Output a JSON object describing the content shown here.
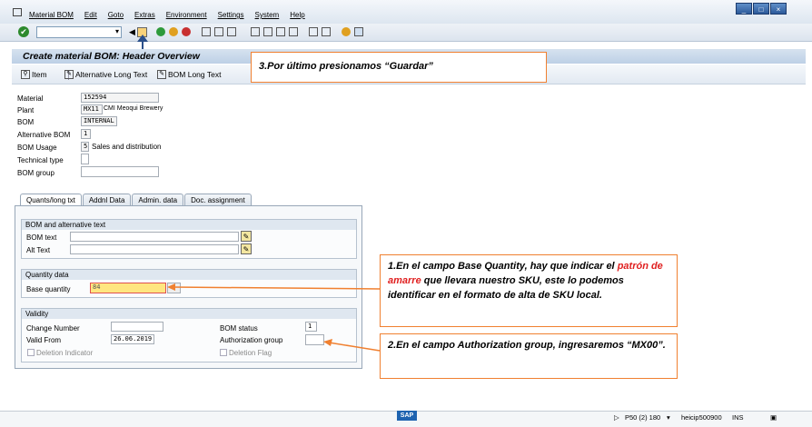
{
  "menu": {
    "items": [
      "Material BOM",
      "Edit",
      "Goto",
      "Extras",
      "Environment",
      "Settings",
      "System",
      "Help"
    ]
  },
  "window_controls": [
    "_",
    "□",
    "×"
  ],
  "header": {
    "title": "Create material BOM: Header Overview"
  },
  "app_toolbar": {
    "item_label": "Item",
    "alt_long_text_label": "Alternative Long Text",
    "bom_long_text_label": "BOM Long Text"
  },
  "fields": {
    "material": {
      "label": "Material",
      "value": "152594"
    },
    "plant": {
      "label": "Plant",
      "value": "MX11",
      "text": "CMI Meoqui Brewery"
    },
    "bom": {
      "label": "BOM",
      "value": "INTERNAL"
    },
    "alt_bom": {
      "label": "Alternative BOM",
      "value": "1"
    },
    "bom_usage": {
      "label": "BOM Usage",
      "value": "5",
      "text": "Sales and distribution"
    },
    "technical_type": {
      "label": "Technical type",
      "value": ""
    },
    "bom_group": {
      "label": "BOM group",
      "value": ""
    }
  },
  "tabs": [
    "Quants/long txt",
    "Addnl Data",
    "Admin. data",
    "Doc. assignment"
  ],
  "groups": {
    "bom_alt_text": {
      "title": "BOM and alternative text",
      "bom_text_label": "BOM text",
      "alt_text_label": "Alt Text"
    },
    "quantity": {
      "title": "Quantity data",
      "base_qty_label": "Base quantity",
      "base_qty_value": "84"
    },
    "validity": {
      "title": "Validity",
      "change_number_label": "Change Number",
      "valid_from_label": "Valid From",
      "valid_from_value": "26.06.2019",
      "deletion_indicator_label": "Deletion Indicator",
      "bom_status_label": "BOM status",
      "bom_status_value": "1",
      "auth_group_label": "Authorization group",
      "deletion_flag_label": "Deletion Flag"
    }
  },
  "callouts": {
    "save": "3.Por último presionamos “Guardar”",
    "base_qty_1": "1.En el campo Base Quantity, hay que indicar el",
    "base_qty_red": "patrón de amarre",
    "base_qty_2": "que llevara nuestro SKU, este lo podemos identificar en el formato de alta de SKU local.",
    "auth_group": "2.En el campo Authorization group, ingresaremos “MX00”."
  },
  "status": {
    "logo": "SAP",
    "system": "P50 (2) 180",
    "server": "heicip500900",
    "mode": "INS"
  },
  "colors": {
    "callout_border": "#f08030",
    "highlight_red": "#e02020",
    "field_highlight": "#ffe680"
  }
}
